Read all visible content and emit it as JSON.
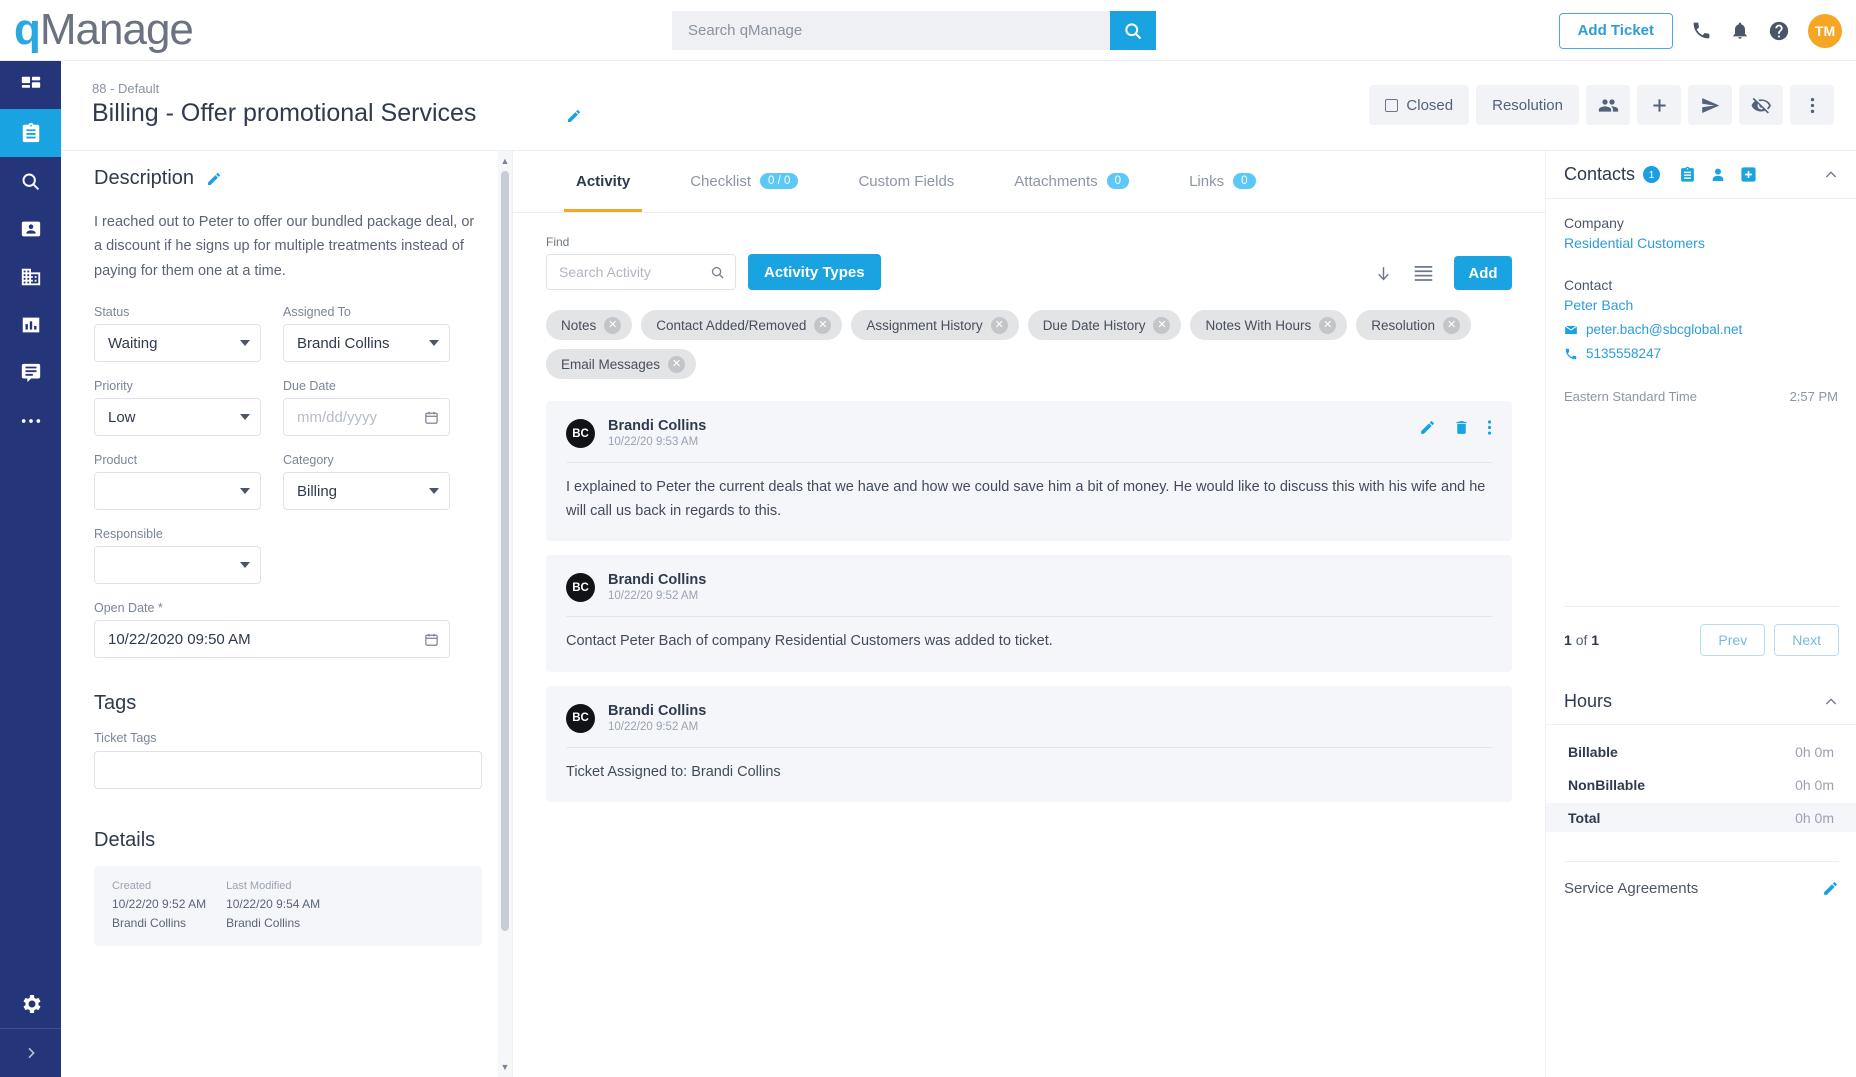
{
  "app": {
    "logo_q": "q",
    "logo_rest": "Manage"
  },
  "search": {
    "placeholder": "Search qManage",
    "icon": "search-icon"
  },
  "topbar": {
    "add_ticket_label": "Add Ticket",
    "phone_icon": "phone-icon",
    "bell_icon": "bell-icon",
    "help_icon": "help-circle-icon",
    "avatar_initials": "TM",
    "avatar_color": "#f5a623"
  },
  "sidebar": {
    "items": [
      {
        "name": "dashboard",
        "icon": "dashboard-icon",
        "active": false
      },
      {
        "name": "tickets",
        "icon": "clipboard-icon",
        "active": true
      },
      {
        "name": "search",
        "icon": "search-icon",
        "active": false
      },
      {
        "name": "contacts",
        "icon": "contact-card-icon",
        "active": false
      },
      {
        "name": "companies",
        "icon": "building-icon",
        "active": false
      },
      {
        "name": "reports",
        "icon": "bar-chart-icon",
        "active": false
      },
      {
        "name": "messages",
        "icon": "chat-icon",
        "active": false
      },
      {
        "name": "more",
        "icon": "ellipsis-icon",
        "active": false
      }
    ],
    "settings_icon": "gear-icon",
    "expand_icon": "chevron-right-icon",
    "active_color": "#19a3e0",
    "bg_color": "#25357a"
  },
  "page": {
    "breadcrumb": "88 - Default",
    "title": "Billing - Offer promotional Services",
    "edit_icon": "pencil-icon"
  },
  "header_actions": {
    "closed_label": "Closed",
    "resolution_label": "Resolution",
    "people_icon": "people-icon",
    "add_icon": "plus-icon",
    "send_icon": "send-icon",
    "hide_icon": "eye-off-icon",
    "more_icon": "kebab-menu-icon"
  },
  "description": {
    "title": "Description",
    "edit_icon": "pencil-icon",
    "text": "I reached out to Peter to offer our bundled package deal, or a discount if he signs up for multiple treatments instead of paying for them one at a time."
  },
  "fields": [
    {
      "label": "Status",
      "value": "Waiting",
      "type": "select"
    },
    {
      "label": "Assigned To",
      "value": "Brandi Collins",
      "type": "select"
    },
    {
      "label": "Priority",
      "value": "Low",
      "type": "select"
    },
    {
      "label": "Due Date",
      "value": "",
      "placeholder": "mm/dd/yyyy",
      "type": "date"
    },
    {
      "label": "Product",
      "value": "",
      "type": "select"
    },
    {
      "label": "Category",
      "value": "Billing",
      "type": "select"
    },
    {
      "label": "Responsible",
      "value": "",
      "type": "select"
    }
  ],
  "open_date": {
    "label": "Open Date *",
    "value": "10/22/2020 09:50 AM",
    "icon": "calendar-icon"
  },
  "tags": {
    "title": "Tags",
    "field_label": "Ticket Tags",
    "value": ""
  },
  "details": {
    "title": "Details",
    "created_label": "Created",
    "created_date": "10/22/20 9:52 AM",
    "created_by": "Brandi Collins",
    "modified_label": "Last Modified",
    "modified_date": "10/22/20 9:54 AM",
    "modified_by": "Brandi Collins"
  },
  "tabs": [
    {
      "label": "Activity",
      "badge": "",
      "active": true
    },
    {
      "label": "Checklist",
      "badge": "0 / 0",
      "active": false
    },
    {
      "label": "Custom Fields",
      "badge": "",
      "active": false
    },
    {
      "label": "Attachments",
      "badge": "0",
      "active": false
    },
    {
      "label": "Links",
      "badge": "0",
      "active": false
    }
  ],
  "activity_toolbar": {
    "find_label": "Find",
    "find_placeholder": "Search Activity",
    "activity_types_label": "Activity Types",
    "sort_icon": "arrow-down-icon",
    "list_icon": "list-view-icon",
    "add_label": "Add"
  },
  "filter_chips": [
    {
      "label": "Notes"
    },
    {
      "label": "Contact Added/Removed"
    },
    {
      "label": "Assignment History"
    },
    {
      "label": "Due Date History"
    },
    {
      "label": "Notes With Hours"
    },
    {
      "label": "Resolution"
    },
    {
      "label": "Email Messages"
    }
  ],
  "activities": [
    {
      "initials": "BC",
      "author": "Brandi Collins",
      "timestamp": "10/22/20 9:53 AM",
      "body": "I explained to Peter the current deals that we have and how we could save him a bit of money. He would like to discuss this with his wife and he will call us back in regards to this.",
      "has_actions": true,
      "edit_icon": "pencil-icon",
      "delete_icon": "trash-icon",
      "more_icon": "kebab-menu-icon"
    },
    {
      "initials": "BC",
      "author": "Brandi Collins",
      "timestamp": "10/22/20 9:52 AM",
      "body": "Contact Peter Bach of company Residential Customers was added to ticket.",
      "has_actions": false
    },
    {
      "initials": "BC",
      "author": "Brandi Collins",
      "timestamp": "10/22/20 9:52 AM",
      "body": "Ticket Assigned to: Brandi Collins",
      "has_actions": false
    }
  ],
  "contacts_panel": {
    "title": "Contacts",
    "count": "1",
    "notes_icon": "clipboard-icon",
    "person_icon": "person-icon",
    "add_icon": "add-box-icon",
    "collapse_icon": "chevron-up-icon",
    "company_label": "Company",
    "company_name": "Residential Customers",
    "contact_label": "Contact",
    "contact_name": "Peter Bach",
    "email_icon": "mail-icon",
    "email": "peter.bach@sbcglobal.net",
    "phone_icon": "phone-icon",
    "phone": "5135558247",
    "timezone_label": "Eastern Standard Time",
    "timezone_time": "2:57 PM",
    "page_current": "1",
    "page_of": "of",
    "page_total": "1",
    "prev_label": "Prev",
    "next_label": "Next"
  },
  "hours_panel": {
    "title": "Hours",
    "collapse_icon": "chevron-up-icon",
    "rows": [
      {
        "label": "Billable",
        "value": "0h 0m"
      },
      {
        "label": "NonBillable",
        "value": "0h 0m"
      },
      {
        "label": "Total",
        "value": "0h 0m"
      }
    ]
  },
  "service_agreements": {
    "title": "Service Agreements",
    "edit_icon": "pencil-icon"
  },
  "colors": {
    "accent_blue": "#19a3e0",
    "nav_navy": "#25357a",
    "tab_active_underline": "#f5a623"
  }
}
